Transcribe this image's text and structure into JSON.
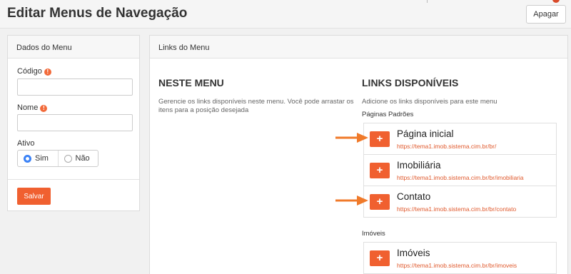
{
  "header": {
    "title": "Editar Menus de Navegação",
    "delete_label": "Apagar"
  },
  "menu_data": {
    "panel_title": "Dados do Menu",
    "code_label": "Código",
    "name_label": "Nome",
    "active_label": "Ativo",
    "yes_label": "Sim",
    "no_label": "Não",
    "selected": "Sim",
    "save_label": "Salvar"
  },
  "menu_links": {
    "panel_title": "Links do Menu",
    "this_menu_heading": "NESTE MENU",
    "this_menu_desc": "Gerencie os links disponíveis neste menu. Você pode arrastar os itens para a posição desejada",
    "available_heading": "LINKS DISPONÍVEIS",
    "available_desc": "Adicione os links disponíveis para este menu",
    "groups": [
      {
        "label": "Páginas Padrões",
        "links": [
          {
            "title": "Página inicial",
            "url": "https://tema1.imob.sistema.cim.br/br/"
          },
          {
            "title": "Imobiliária",
            "url": "https://tema1.imob.sistema.cim.br/br/imobiliaria"
          },
          {
            "title": "Contato",
            "url": "https://tema1.imob.sistema.cim.br/br/contato"
          }
        ]
      },
      {
        "label": "Imóveis",
        "links": [
          {
            "title": "Imóveis",
            "url": "https://tema1.imob.sistema.cim.br/br/imoveis"
          }
        ]
      }
    ]
  },
  "icons": {
    "plus": "+",
    "info": "!"
  },
  "colors": {
    "accent": "#f06030",
    "radio": "#3b82f6",
    "url": "#e05a2e"
  }
}
